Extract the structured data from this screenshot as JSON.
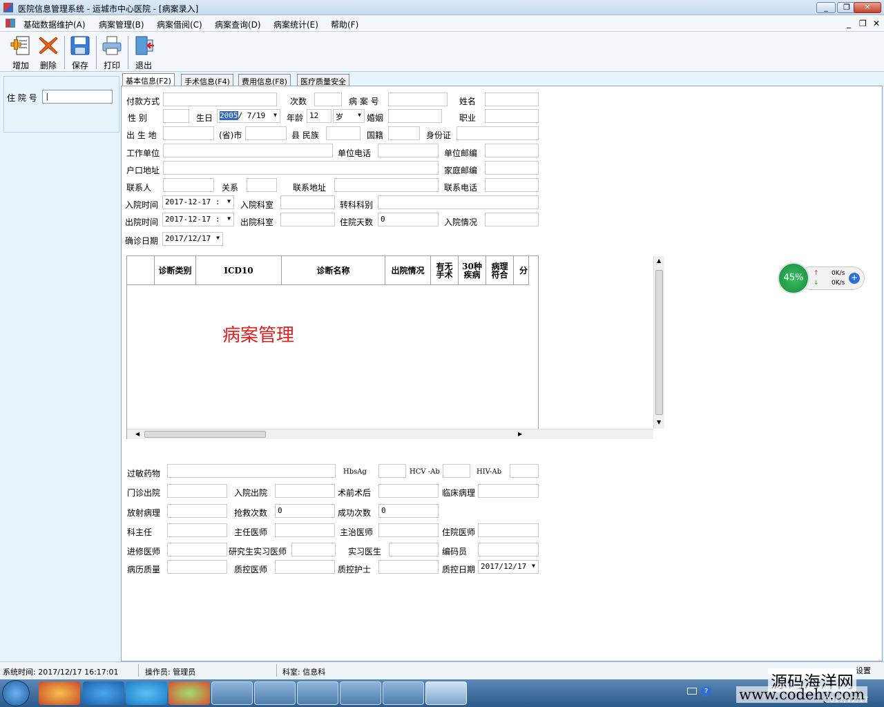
{
  "window": {
    "title": "医院信息管理系统    -    运城市中心医院 - [病案录入]"
  },
  "menu": [
    "基础数据维护(A)",
    "病案管理(B)",
    "病案借阅(C)",
    "病案查询(D)",
    "病案统计(E)",
    "帮助(F)"
  ],
  "toolbar": {
    "add": "增加",
    "delete": "删除",
    "save": "保存",
    "print": "打印",
    "exit": "退出"
  },
  "left": {
    "admission_no_label": "住 院 号"
  },
  "tabs": [
    "基本信息(F2)",
    "手术信息(F4)",
    "费用信息(F8)",
    "医疗质量安全"
  ],
  "form": {
    "payment_method": "付款方式",
    "times": "次数",
    "case_no": "病 案 号",
    "name": "姓名",
    "sex": "性    别",
    "birthday": "生日",
    "birthday_year": "2005",
    "birthday_rest": "/  7/19",
    "age": "年龄",
    "age_value": "12",
    "age_unit": "岁",
    "marriage": "婚姻",
    "occupation": "职业",
    "birthplace": "出 生 地",
    "province_city": "(省)市",
    "county_ethnicity": "县  民族",
    "nationality": "国籍",
    "id_card": "身份证",
    "work_unit": "工作单位",
    "unit_phone": "单位电话",
    "unit_postcode": "单位邮编",
    "residence": "户口地址",
    "home_postcode": "家庭邮编",
    "contact": "联系人",
    "relation": "关系",
    "contact_address": "联系地址",
    "contact_phone": "联系电话",
    "admit_time": "入院时间",
    "admit_time_value": "2017-12-17 :",
    "admit_dept": "入院科室",
    "transfer_dept": "转科科别",
    "discharge_time": "出院时间",
    "discharge_time_value": "2017-12-17 :",
    "discharge_dept": "出院科室",
    "stay_days": "住院天数",
    "stay_days_value": "0",
    "admit_status": "入院情况",
    "diagnosis_date": "确诊日期",
    "diagnosis_date_value": "2017/12/17"
  },
  "grid": {
    "headers": [
      "",
      "诊断类别",
      "ICD10",
      "诊断名称",
      "出院情况",
      "有无手术",
      "30种疾病",
      "病理符合",
      "分"
    ],
    "watermark": "病案管理"
  },
  "lower": {
    "allergy": "过敏药物",
    "hbsag": "HbsAg",
    "hcv": "HCV -Ab",
    "hiv": "HIV-Ab",
    "op_dis": "门诊出院",
    "adm_dis": "入院出院",
    "pre_post": "术前术后",
    "clin_path": "临床病理",
    "rad_path": "放射病理",
    "rescue": "抢救次数",
    "rescue_value": "0",
    "success": "成功次数",
    "success_value": "0",
    "chief": "科主任",
    "attending_chief": "主任医师",
    "attending": "主治医师",
    "resident": "住院医师",
    "trainee": "进修医师",
    "grad_intern": "研究生实习医师",
    "intern": "实习医生",
    "coder": "编码员",
    "record_quality": "病历质量",
    "qc_doctor": "质控医师",
    "qc_nurse": "质控护士",
    "qc_date": "质控日期",
    "qc_date_value": "2017/12/17"
  },
  "widget": {
    "percent": "45%",
    "up": "0K/s",
    "down": "0K/s"
  },
  "status": {
    "time": "系统时间: 2017/12/17 16:17:01",
    "operator": "操作员: 管理员",
    "dept": "科室: 信息科",
    "settings": "设置"
  },
  "taskbar": {
    "watermark": "源码海洋网",
    "url": "www.codehy.com",
    "date": "2017/12/17"
  }
}
